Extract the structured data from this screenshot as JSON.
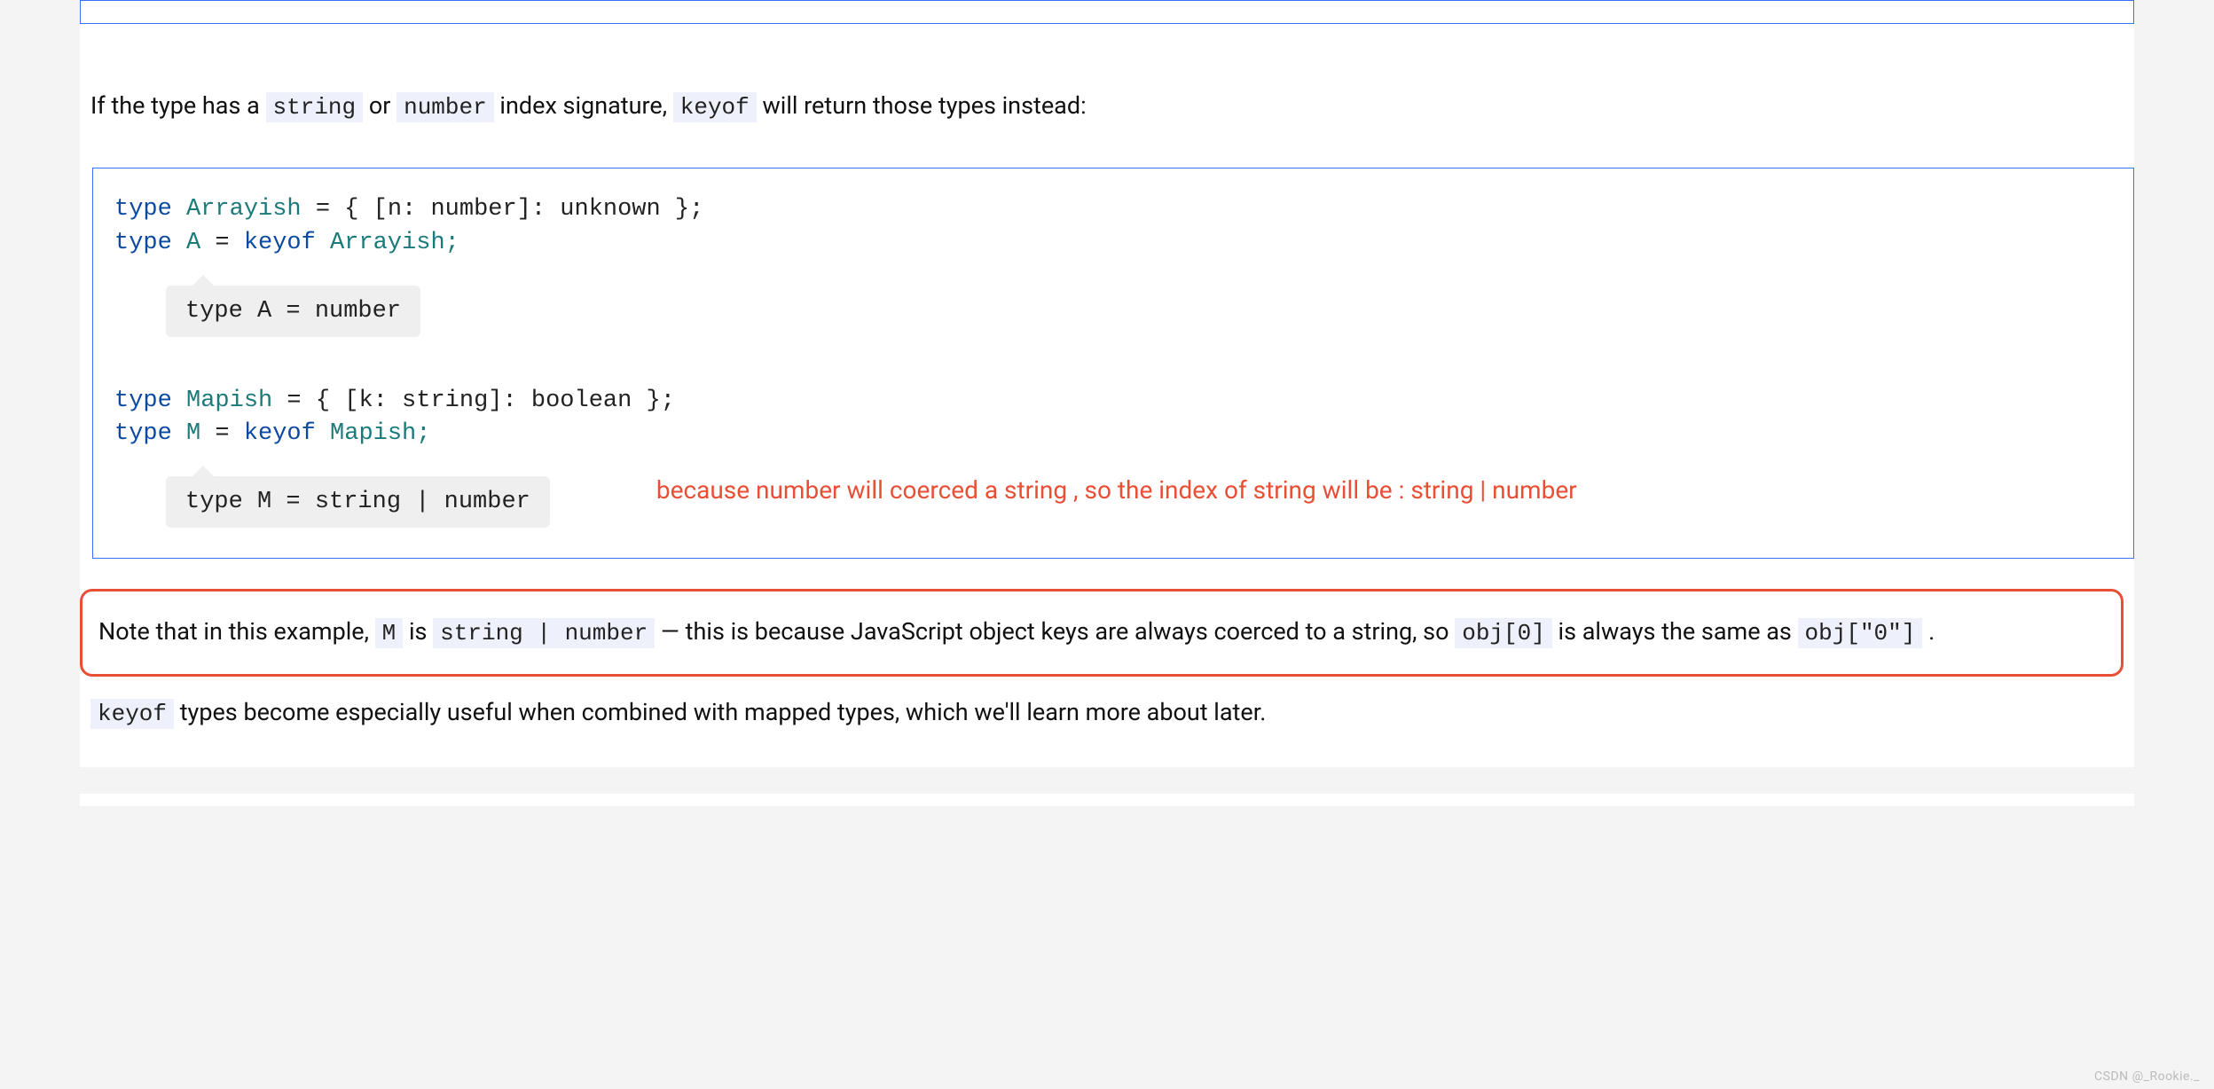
{
  "intro": {
    "t1": "If the type has a ",
    "c1": "string",
    "t2": " or ",
    "c2": "number",
    "t3": " index signature, ",
    "c3": "keyof",
    "t4": " will return those types instead:"
  },
  "code1": {
    "l1": {
      "kw": "type",
      "name": "Arrayish",
      "eq": " = ",
      "body": "{ [n: number]: unknown };"
    },
    "l2": {
      "kw": "type",
      "name": "A",
      "eq": " = ",
      "kw2": "keyof",
      "ref": " Arrayish;"
    },
    "hint": "type A = number"
  },
  "code2": {
    "l1": {
      "kw": "type",
      "name": "Mapish",
      "eq": " = ",
      "body": "{ [k: string]: boolean };"
    },
    "l2": {
      "kw": "type",
      "name": "M",
      "eq": " = ",
      "kw2": "keyof",
      "ref": " Mapish;"
    },
    "hint": "type M = string | number"
  },
  "annotation": "because  number will coerced a string ,   so the index of string will be  :    string | number",
  "note": {
    "t1": "Note that in this example, ",
    "c1": "M",
    "t2": " is ",
    "c2": "string | number",
    "t3": " — this is because JavaScript object keys are always coerced to a string, so ",
    "c3": "obj[0]",
    "t4": " is always the same as ",
    "c4": "obj[\"0\"]",
    "t5": "."
  },
  "after": {
    "c1": "keyof",
    "t1": " types become especially useful when combined with mapped types, which we'll learn more about later."
  },
  "watermark": "CSDN @_Rookie._"
}
